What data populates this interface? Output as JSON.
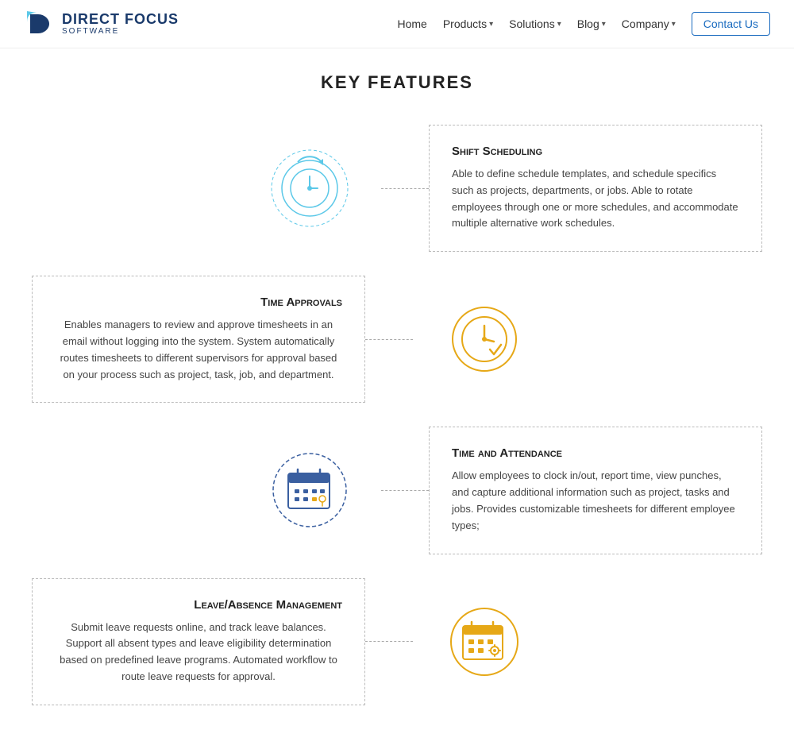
{
  "header": {
    "logo_brand": "DIRECT FOCUS",
    "logo_sub": "SOFTWARE",
    "nav_items": [
      {
        "label": "Home",
        "has_dropdown": false
      },
      {
        "label": "Products",
        "has_dropdown": true
      },
      {
        "label": "Solutions",
        "has_dropdown": true
      },
      {
        "label": "Blog",
        "has_dropdown": true
      },
      {
        "label": "Company",
        "has_dropdown": true
      }
    ],
    "contact_label": "Contact Us"
  },
  "page": {
    "section_title": "KEY FEATURES"
  },
  "features": [
    {
      "id": "shift-scheduling",
      "title": "Shift Scheduling",
      "description": "Able to define schedule templates, and schedule specifics such as projects, departments, or jobs. Able to rotate employees through one or more schedules, and accommodate multiple alternative work schedules.",
      "icon_type": "shift",
      "layout": "icon-left-card-right"
    },
    {
      "id": "time-approvals",
      "title": "Time Approvals",
      "description": "Enables managers to review and approve timesheets in an email without logging into the system. System automatically routes timesheets to different supervisors for approval based on your process such as project, task, job, and department.",
      "icon_type": "time-approval",
      "layout": "card-left-icon-right"
    },
    {
      "id": "time-attendance",
      "title": "Time and Attendance",
      "description": "Allow employees to clock in/out, report time, view punches, and capture additional information such as project, tasks and jobs. Provides customizable timesheets for different employee types;",
      "icon_type": "time-attendance",
      "layout": "icon-left-card-right"
    },
    {
      "id": "leave-absence",
      "title": "Leave/Absence Management",
      "description": "Submit leave requests online, and track leave balances. Support all absent types and leave eligibility determination based on predefined leave programs. Automated workflow to route leave requests for approval.",
      "icon_type": "leave",
      "layout": "card-left-icon-right"
    }
  ],
  "colors": {
    "blue_light": "#5bc8e8",
    "blue_dark": "#3a5fa0",
    "gold": "#e6a817",
    "text_dark": "#222",
    "text_medium": "#444",
    "border": "#bbb"
  }
}
